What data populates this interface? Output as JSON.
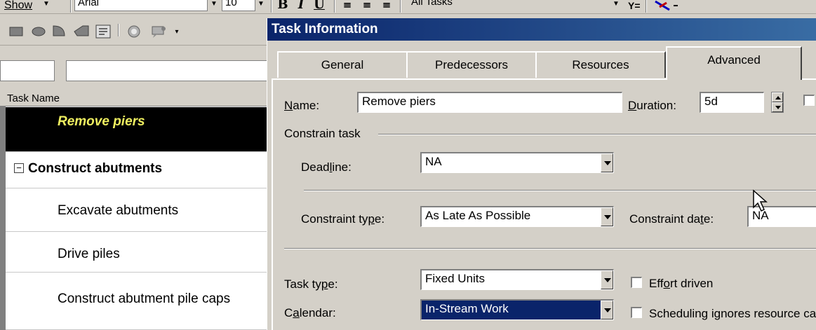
{
  "toolbar": {
    "show_label": "Show",
    "font_name": "Arial",
    "font_size": "10",
    "bold": "B",
    "italic": "I",
    "underline": "U",
    "filter": "All Tasks",
    "autofilter": "Y="
  },
  "drawing_toolbar": {
    "icons": [
      "rectangle-icon",
      "oval-icon",
      "arc-icon",
      "polygon-icon",
      "text-box-icon",
      "cycle-fill-color-icon",
      "attach-to-task-icon"
    ]
  },
  "grid": {
    "header": "Task Name",
    "rows": [
      {
        "name": "Remove piers",
        "selected": true
      },
      {
        "name": "Construct abutments",
        "summary": true,
        "collapse": "−"
      },
      {
        "name": "Excavate abutments"
      },
      {
        "name": "Drive piles"
      },
      {
        "name": "Construct abutment pile caps"
      }
    ]
  },
  "dialog": {
    "title": "Task Information",
    "tabs": [
      "General",
      "Predecessors",
      "Resources",
      "Advanced"
    ],
    "active_tab": "Advanced",
    "name_label": "Name:",
    "name_value": "Remove piers",
    "duration_label": "Duration:",
    "duration_value": "5d",
    "constrain_group": "Constrain task",
    "deadline_label": "Deadline:",
    "deadline_value": "NA",
    "constraint_type_label": "Constraint type:",
    "constraint_type_value": "As Late As Possible",
    "constraint_date_label": "Constraint date:",
    "constraint_date_value": "NA",
    "task_type_label": "Task type:",
    "task_type_value": "Fixed Units",
    "effort_driven_label": "Effort driven",
    "effort_driven_checked": false,
    "calendar_label": "Calendar:",
    "calendar_value": "In-Stream Work",
    "scheduling_ignores_label": "Scheduling ignores resource calendars",
    "scheduling_ignores_checked": false
  },
  "colors": {
    "titlebar_start": "#0a246a",
    "titlebar_end": "#3a6ea5",
    "selected_row_text": "#f0f060",
    "selection_highlight": "#0a246a",
    "face": "#d4d0c8"
  }
}
